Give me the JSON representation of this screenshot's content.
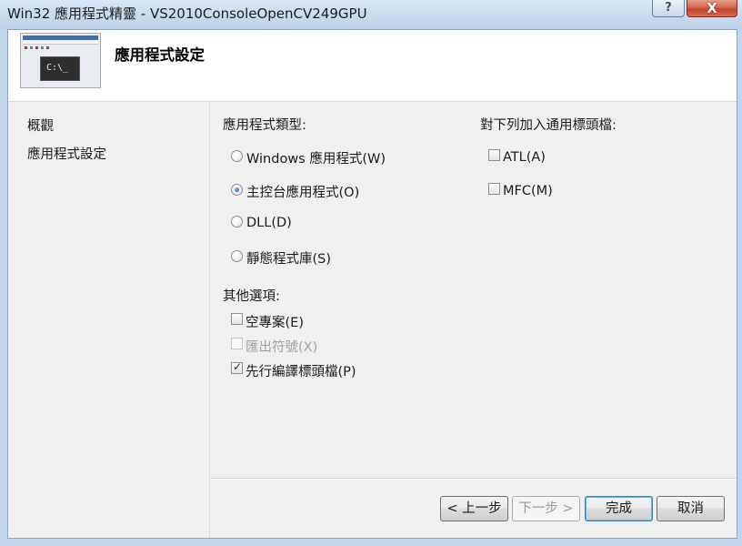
{
  "window": {
    "title": "Win32 應用程式精靈 - VS2010ConsoleOpenCV249GPU",
    "help_glyph": "?",
    "close_glyph": "X"
  },
  "header": {
    "title": "應用程式設定",
    "banner_console_text": "C:\\_"
  },
  "nav": {
    "items": [
      {
        "label": "概觀"
      },
      {
        "label": "應用程式設定"
      }
    ]
  },
  "app_type": {
    "label": "應用程式類型:",
    "options": [
      {
        "label": "Windows 應用程式(W)",
        "selected": false
      },
      {
        "label": "主控台應用程式(O)",
        "selected": true
      },
      {
        "label": "DLL(D)",
        "selected": false
      },
      {
        "label": "靜態程式庫(S)",
        "selected": false
      }
    ]
  },
  "other_options": {
    "label": "其他選項:",
    "options": [
      {
        "label": "空專案(E)",
        "checked": false,
        "enabled": true
      },
      {
        "label": "匯出符號(X)",
        "checked": false,
        "enabled": false
      },
      {
        "label": "先行編譯標頭檔(P)",
        "checked": true,
        "enabled": true
      }
    ]
  },
  "headers": {
    "label": "對下列加入通用標頭檔:",
    "options": [
      {
        "label": "ATL(A)",
        "checked": false
      },
      {
        "label": "MFC(M)",
        "checked": false
      }
    ]
  },
  "buttons": {
    "back": "< 上一步",
    "next": "下一步 >",
    "finish": "完成",
    "cancel": "取消"
  }
}
